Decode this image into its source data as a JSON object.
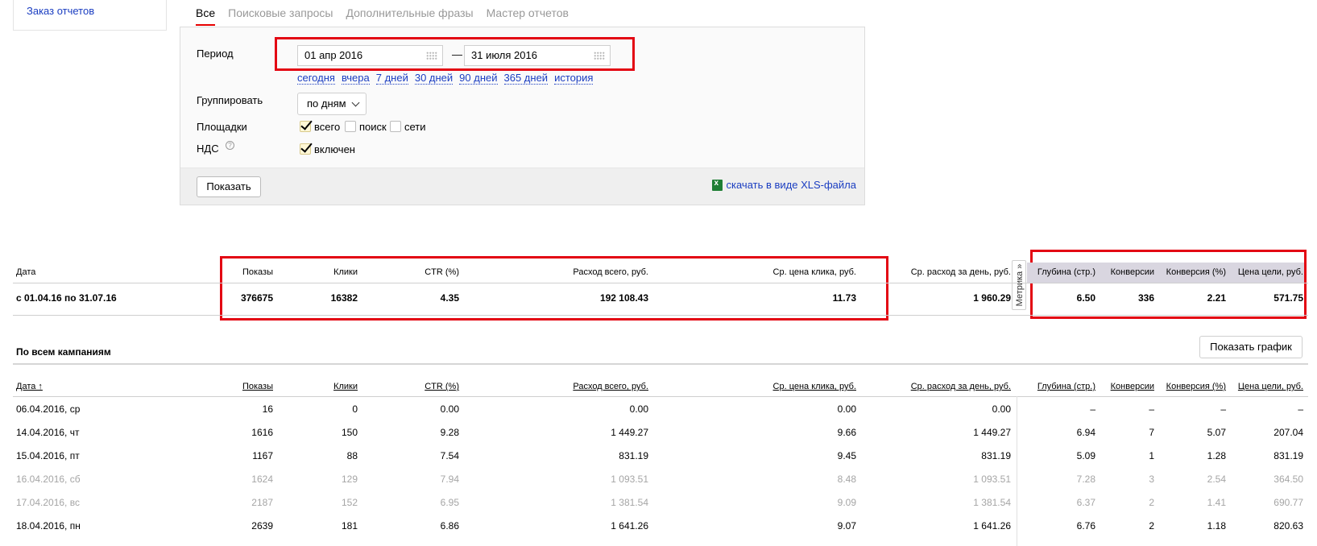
{
  "sidebar": {
    "report_order_link": "Заказ отчетов"
  },
  "tabs": [
    {
      "label": "Все",
      "active": true
    },
    {
      "label": "Поисковые запросы",
      "active": false
    },
    {
      "label": "Дополнительные фразы",
      "active": false
    },
    {
      "label": "Мастер отчетов",
      "active": false
    }
  ],
  "filters": {
    "period_label": "Период",
    "date_from": "01 апр 2016",
    "date_separator": "—",
    "date_to": "31 июля 2016",
    "quick_links": [
      "сегодня",
      "вчера",
      "7 дней",
      "30 дней",
      "90 дней",
      "365 дней",
      "история"
    ],
    "group_label": "Группировать",
    "group_value": "по дням",
    "platforms_label": "Площадки",
    "platforms": [
      {
        "label": "всего",
        "checked": true
      },
      {
        "label": "поиск",
        "checked": false
      },
      {
        "label": "сети",
        "checked": false
      }
    ],
    "vat_label": "НДС",
    "vat_help": "?",
    "vat_option": {
      "label": "включен",
      "checked": true
    },
    "show_button": "Показать",
    "xls_link": "скачать в виде XLS-файла"
  },
  "summary": {
    "headers": [
      "Дата",
      "Показы",
      "Клики",
      "CTR (%)",
      "Расход всего, руб.",
      "Ср. цена клика, руб.",
      "Ср. расход за день, руб.",
      "Глубина (стр.)",
      "Конверсии",
      "Конверсия (%)",
      "Цена цели, руб."
    ],
    "values": [
      "с 01.04.16 по 31.07.16",
      "376675",
      "16382",
      "4.35",
      "192 108.43",
      "11.73",
      "1 960.29",
      "6.50",
      "336",
      "2.21",
      "571.75"
    ],
    "metrika_tab": "Метрика »"
  },
  "campaigns": {
    "title": "По всем кампаниям",
    "chart_button": "Показать график",
    "headers": [
      "Дата ↑",
      "Показы",
      "Клики",
      "CTR (%)",
      "Расход всего, руб.",
      "Ср. цена клика, руб.",
      "Ср. расход за день, руб.",
      "Глубина (стр.)",
      "Конверсии",
      "Конверсия (%)",
      "Цена цели, руб."
    ],
    "rows": [
      {
        "weekend": false,
        "cells": [
          "06.04.2016, ср",
          "16",
          "0",
          "0.00",
          "0.00",
          "0.00",
          "0.00",
          "–",
          "–",
          "–",
          "–"
        ]
      },
      {
        "weekend": false,
        "cells": [
          "14.04.2016, чт",
          "1616",
          "150",
          "9.28",
          "1 449.27",
          "9.66",
          "1 449.27",
          "6.94",
          "7",
          "5.07",
          "207.04"
        ]
      },
      {
        "weekend": false,
        "cells": [
          "15.04.2016, пт",
          "1167",
          "88",
          "7.54",
          "831.19",
          "9.45",
          "831.19",
          "5.09",
          "1",
          "1.28",
          "831.19"
        ]
      },
      {
        "weekend": true,
        "cells": [
          "16.04.2016, сб",
          "1624",
          "129",
          "7.94",
          "1 093.51",
          "8.48",
          "1 093.51",
          "7.28",
          "3",
          "2.54",
          "364.50"
        ]
      },
      {
        "weekend": true,
        "cells": [
          "17.04.2016, вс",
          "2187",
          "152",
          "6.95",
          "1 381.54",
          "9.09",
          "1 381.54",
          "6.37",
          "2",
          "1.41",
          "690.77"
        ]
      },
      {
        "weekend": false,
        "cells": [
          "18.04.2016, пн",
          "2639",
          "181",
          "6.86",
          "1 641.26",
          "9.07",
          "1 641.26",
          "6.76",
          "2",
          "1.18",
          "820.63"
        ]
      }
    ]
  },
  "colors": {
    "link": "#1a3dc1",
    "active_tab_underline": "#e60000",
    "annotation_red": "#e30613",
    "metrika_header_bg": "#d9d6e0",
    "weekend_text": "#a5a5a5"
  }
}
